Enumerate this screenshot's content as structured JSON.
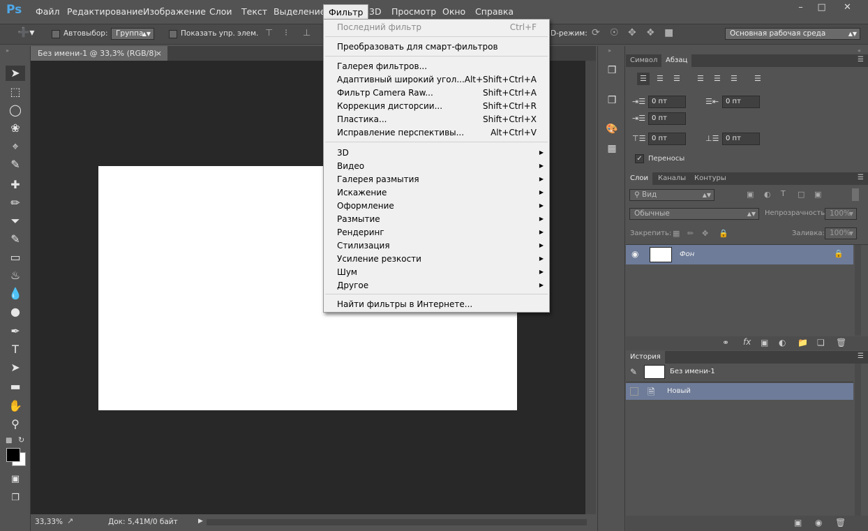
{
  "app": {
    "logo": "Ps"
  },
  "menubar": {
    "items": [
      "Файл",
      "Редактирование",
      "Изображение",
      "Слои",
      "Текст",
      "Выделение",
      "Фильтр",
      "3D",
      "Просмотр",
      "Окно",
      "Справка"
    ],
    "active": "Фильтр"
  },
  "options": {
    "autoselect_label": "Автовыбор:",
    "autoselect_value": "Группа",
    "show_controls_label": "Показать упр. элем.",
    "mode_label": "D-режим:",
    "workspace": "Основная рабочая среда"
  },
  "document": {
    "tab_title": "Без имени-1 @ 33,3% (RGB/8)",
    "tab_close": "×"
  },
  "status": {
    "zoom": "33,33%",
    "doc_size": "Док: 5,41M/0 байт"
  },
  "filter_menu": {
    "last_filter": {
      "label": "Последний фильтр",
      "shortcut": "Ctrl+F"
    },
    "smart": "Преобразовать для смарт-фильтров",
    "group1": [
      {
        "label": "Галерея фильтров...",
        "shortcut": ""
      },
      {
        "label": "Адаптивный широкий угол...",
        "shortcut": "Alt+Shift+Ctrl+A"
      },
      {
        "label": "Фильтр Camera Raw...",
        "shortcut": "Shift+Ctrl+A"
      },
      {
        "label": "Коррекция дисторсии...",
        "shortcut": "Shift+Ctrl+R"
      },
      {
        "label": "Пластика...",
        "shortcut": "Shift+Ctrl+X"
      },
      {
        "label": "Исправление перспективы...",
        "shortcut": "Alt+Ctrl+V"
      }
    ],
    "submenus": [
      "3D",
      "Видео",
      "Галерея размытия",
      "Искажение",
      "Оформление",
      "Размытие",
      "Рендеринг",
      "Стилизация",
      "Усиление резкости",
      "Шум",
      "Другое"
    ],
    "online": "Найти фильтры в Интернете..."
  },
  "paragraph_panel": {
    "tabs": [
      "Символ",
      "Абзац"
    ],
    "active_tab": "Абзац",
    "indent_left": "0 пт",
    "indent_right": "0 пт",
    "indent_first": "0 пт",
    "space_before": "0 пт",
    "space_after": "0 пт",
    "hyphenation_label": "Переносы"
  },
  "layers_panel": {
    "tabs": [
      "Слои",
      "Каналы",
      "Контуры"
    ],
    "active_tab": "Слои",
    "filter_kind": "Вид",
    "blend_mode": "Обычные",
    "opacity_label": "Непрозрачность:",
    "opacity_value": "100%",
    "lock_label": "Закрепить:",
    "fill_label": "Заливка:",
    "fill_value": "100%",
    "layers": [
      {
        "name": "Фон",
        "locked": true,
        "visible": true
      }
    ]
  },
  "history_panel": {
    "title": "История",
    "snapshot": "Без имени-1",
    "items": [
      "Новый"
    ]
  },
  "colors": {
    "accent": "#4fa8e8",
    "selected_row": "#6e7c99",
    "canvas_bg": "#282828",
    "panel_bg": "#535353"
  }
}
